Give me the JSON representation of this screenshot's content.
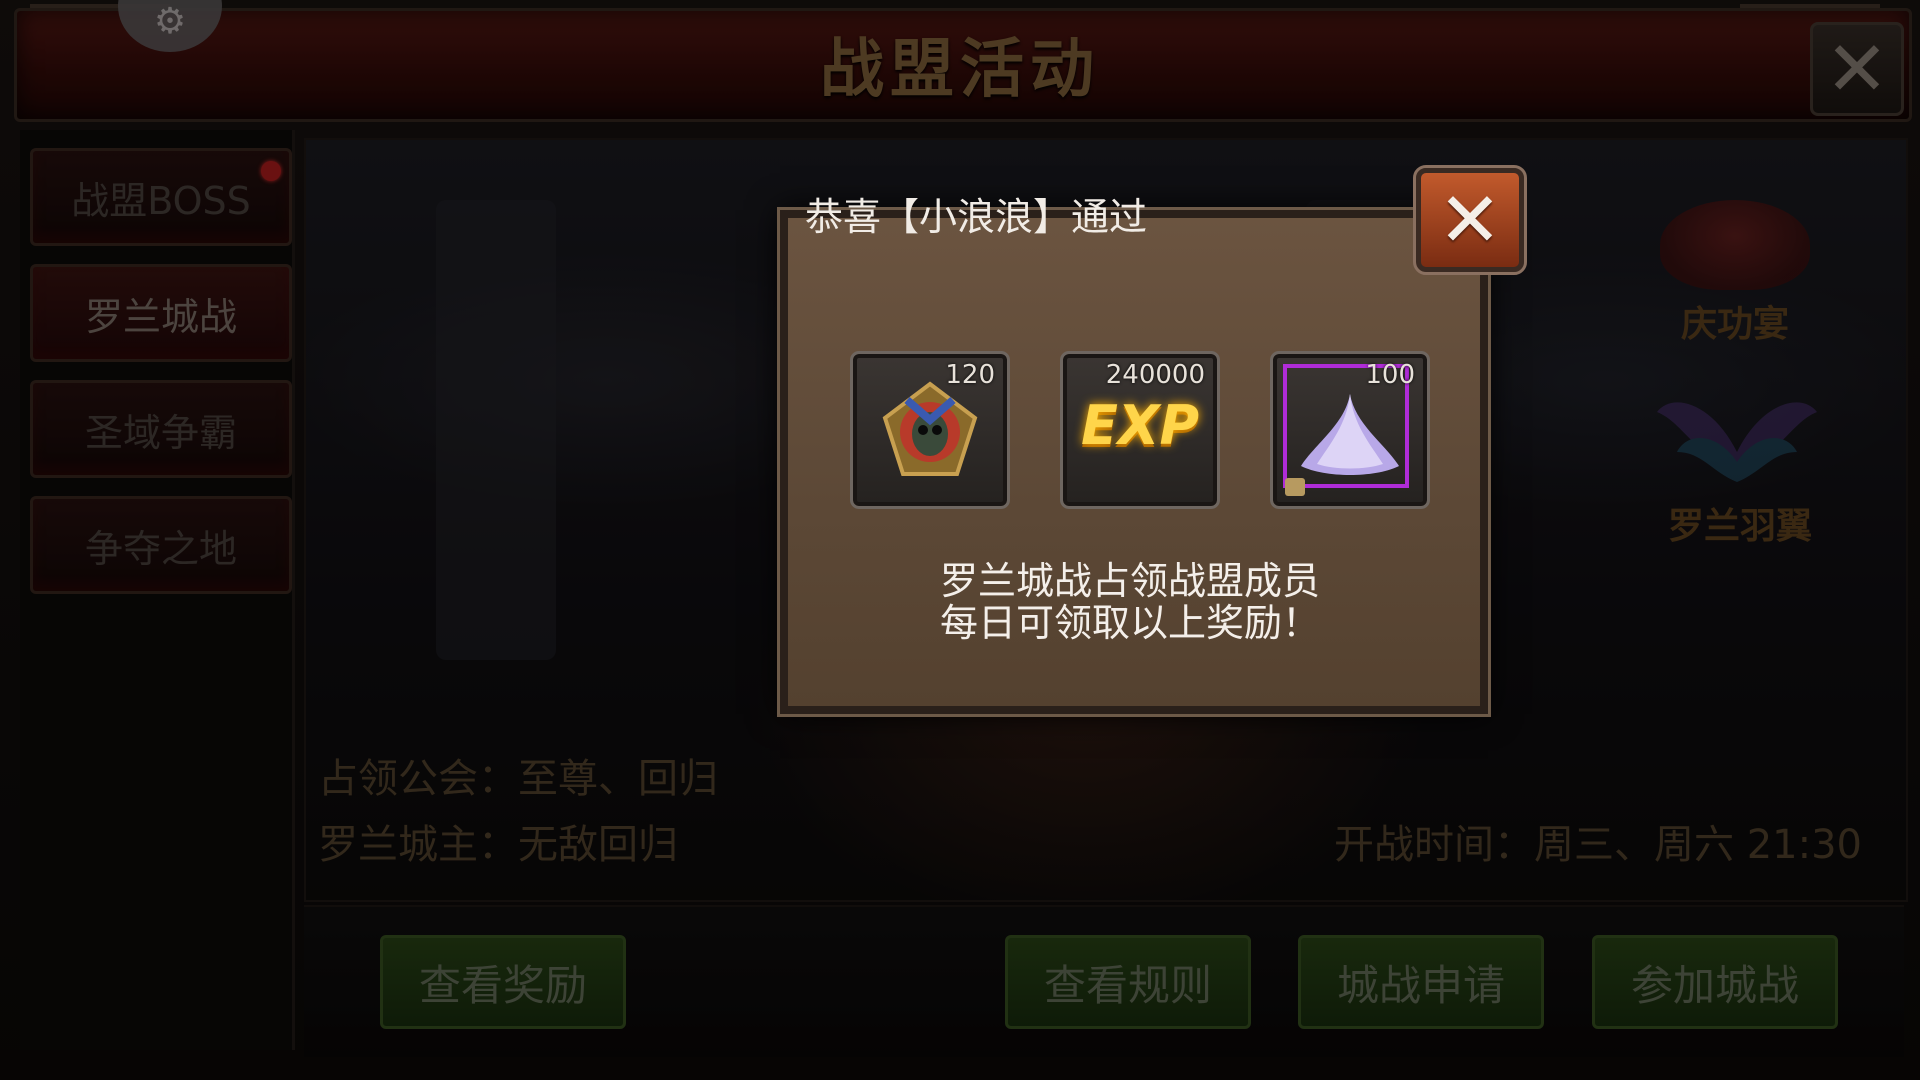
{
  "window": {
    "title": "战盟活动"
  },
  "sidebar": {
    "items": [
      {
        "label": "战盟BOSS",
        "has_badge": true,
        "active": false
      },
      {
        "label": "罗兰城战",
        "has_badge": false,
        "active": true
      },
      {
        "label": "圣域争霸",
        "has_badge": false,
        "active": false
      },
      {
        "label": "争夺之地",
        "has_badge": false,
        "active": false
      }
    ]
  },
  "main": {
    "occupying_guild": "占领公会：至尊、回归",
    "city_lord": "罗兰城主：无敌回归",
    "battle_time": "开战时间：周三、周六 21:30",
    "features": [
      {
        "label": "庆功宴",
        "icon": "banquet-table-icon"
      },
      {
        "label": "罗兰羽翼",
        "icon": "wings-icon"
      }
    ],
    "buttons": {
      "view_rewards": "查看奖励",
      "view_rules": "查看规则",
      "apply": "城战申请",
      "join": "参加城战"
    }
  },
  "modal": {
    "title": "恭喜【小浪浪】通过",
    "rewards": [
      {
        "icon": "skull-emblem-icon",
        "count": "120"
      },
      {
        "icon": "exp-icon",
        "label": "EXP",
        "count": "240000"
      },
      {
        "icon": "purple-powder-icon",
        "count": "100",
        "locked": true
      }
    ],
    "description_line1": "罗兰城战占领战盟成员",
    "description_line2": "每日可领取以上奖励！"
  },
  "colors": {
    "title_text": "#8c6a3e",
    "green_button": "#2d4a18",
    "close_button": "#c25a2c",
    "rare_border": "#b02cd8"
  }
}
